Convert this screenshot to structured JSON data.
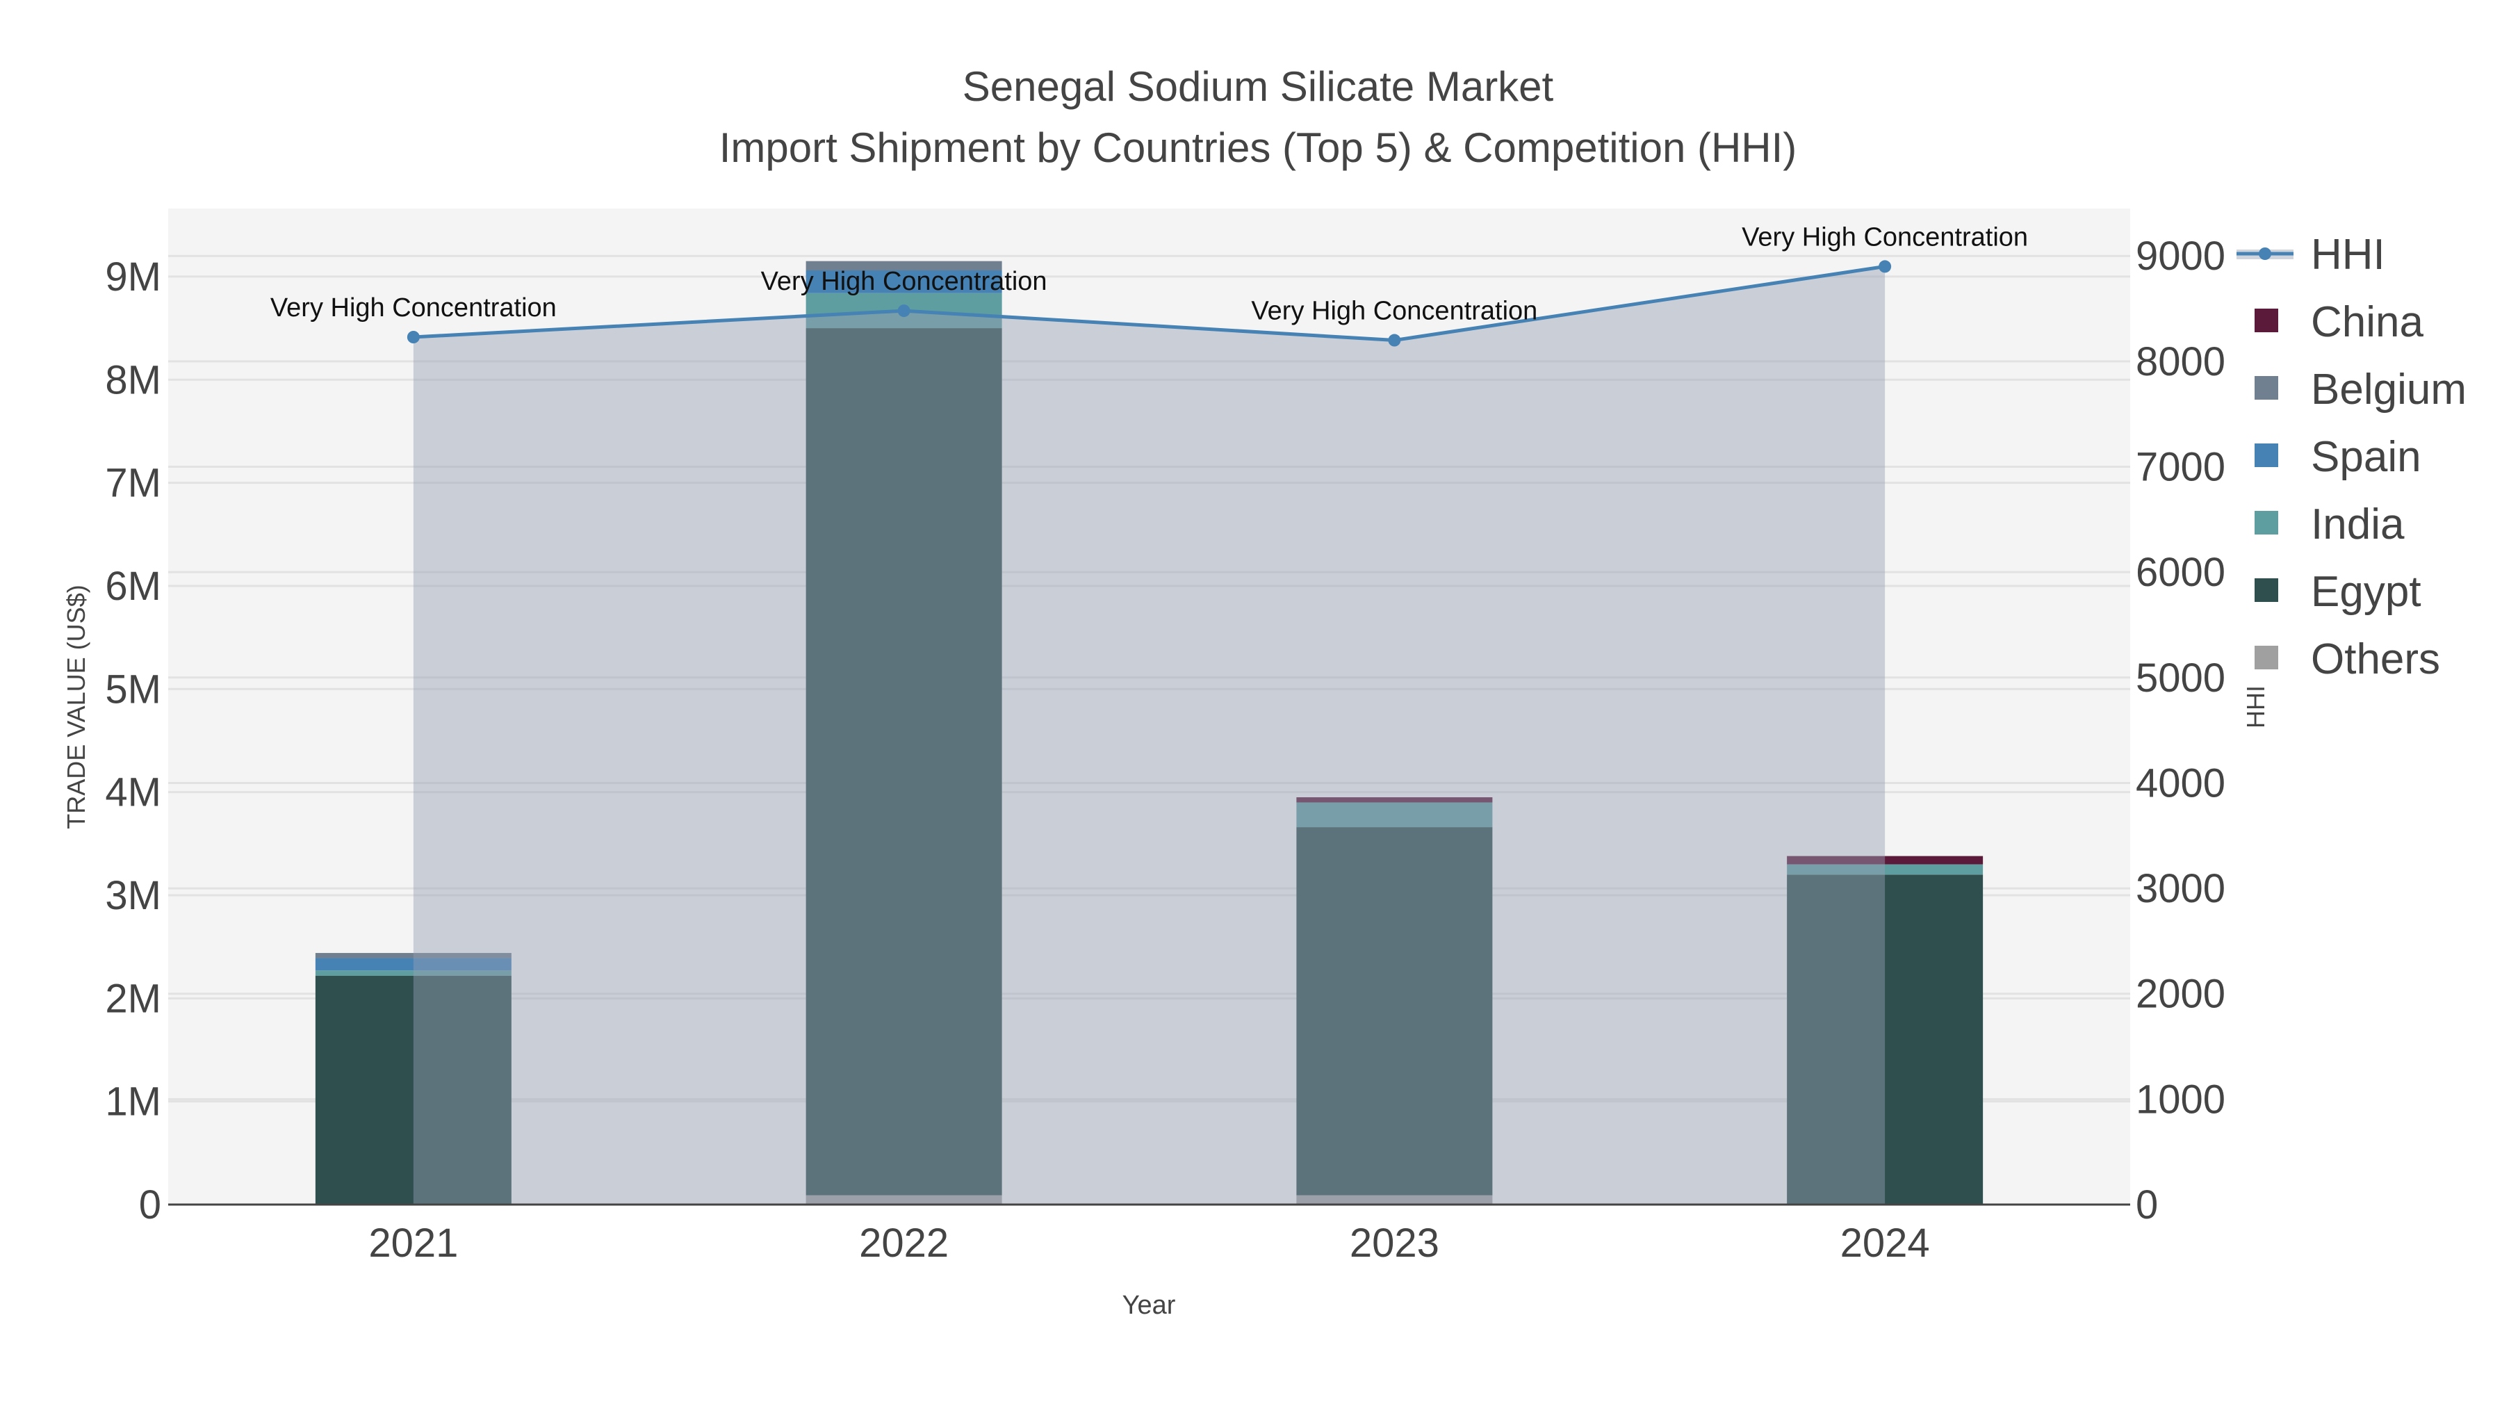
{
  "chart_data": {
    "type": "bar",
    "title": "Senegal Sodium Silicate Market",
    "subtitle": "Import Shipment by Countries (Top 5) & Competition (HHI)",
    "xlabel": "Year",
    "ylabel": "TRADE VALUE (US$)",
    "y2label": "HHI",
    "categories": [
      "2021",
      "2022",
      "2023",
      "2024"
    ],
    "ylim": [
      0,
      9660000
    ],
    "y2lim": [
      0,
      9450
    ],
    "yticks": [
      0,
      1000000,
      2000000,
      3000000,
      4000000,
      5000000,
      6000000,
      7000000,
      8000000,
      9000000
    ],
    "ytick_labels": [
      "0",
      "1M",
      "2M",
      "3M",
      "4M",
      "5M",
      "6M",
      "7M",
      "8M",
      "9M"
    ],
    "y2ticks": [
      0,
      1000,
      2000,
      3000,
      4000,
      5000,
      6000,
      7000,
      8000,
      9000
    ],
    "y2tick_labels": [
      "0",
      "1000",
      "2000",
      "3000",
      "4000",
      "5000",
      "6000",
      "7000",
      "8000",
      "9000"
    ],
    "series": [
      {
        "name": "Others",
        "color": "#a0a0a0",
        "values": [
          0,
          90000,
          90000,
          0
        ]
      },
      {
        "name": "Egypt",
        "color": "#2f4f4f",
        "values": [
          2220000,
          8410000,
          3570000,
          3200000
        ]
      },
      {
        "name": "India",
        "color": "#5f9ea0",
        "values": [
          50000,
          340000,
          240000,
          100000
        ]
      },
      {
        "name": "Spain",
        "color": "#4682b4",
        "values": [
          120000,
          220000,
          0,
          0
        ]
      },
      {
        "name": "Belgium",
        "color": "#708090",
        "values": [
          50000,
          90000,
          0,
          0
        ]
      },
      {
        "name": "China",
        "color": "#5c1a3a",
        "values": [
          0,
          0,
          50000,
          80000
        ]
      }
    ],
    "hhi": {
      "name": "HHI",
      "color": "#4682b4",
      "values": [
        8230,
        8480,
        8200,
        8900
      ],
      "annotations": [
        "Very High Concentration",
        "Very High Concentration",
        "Very High Concentration",
        "Very High Concentration"
      ]
    },
    "legend": [
      "HHI",
      "China",
      "Belgium",
      "Spain",
      "India",
      "Egypt",
      "Others"
    ],
    "legend_position": "right",
    "grid": true
  }
}
